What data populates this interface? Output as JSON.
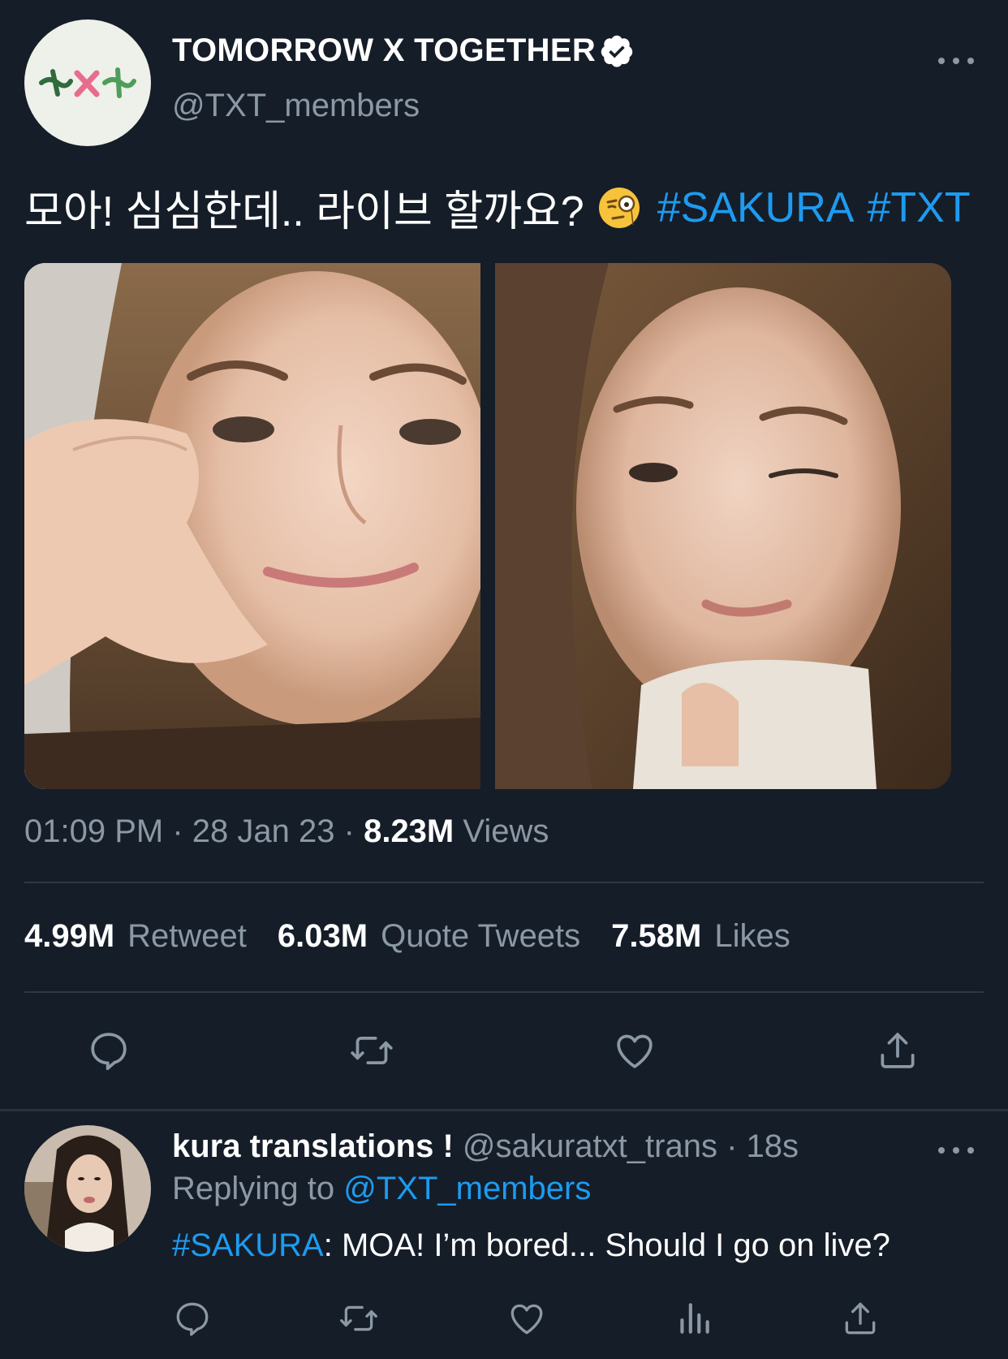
{
  "tweet": {
    "display_name": "TOMORROW X TOGETHER",
    "handle": "@TXT_members",
    "text": "모아! 심심한데.. 라이브 할까요?",
    "hashtags": [
      "#SAKURA",
      "#TXT"
    ],
    "time": "01:09 PM",
    "date": "28 Jan 23",
    "sep": "·",
    "views_count": "8.23M",
    "views_label": "Views",
    "retweet_count": "4.99M",
    "retweet_label": "Retweet",
    "quote_count": "6.03M",
    "quote_label": "Quote Tweets",
    "likes_count": "7.58M",
    "likes_label": "Likes"
  },
  "reply": {
    "display_name": "kura translations !",
    "handle": "@sakuratxt_trans",
    "sep": "·",
    "age": "18s",
    "replying_label": "Replying to",
    "replying_handle": "@TXT_members",
    "hashtag": "#SAKURA",
    "text": ": MOA! I’m bored... Should I go on live?"
  },
  "icons": {
    "main_actions": [
      "reply-icon",
      "retweet-icon",
      "like-icon",
      "share-icon"
    ],
    "reply_actions": [
      "reply-icon",
      "retweet-icon",
      "like-icon",
      "views-icon",
      "share-icon"
    ]
  },
  "colors": {
    "background": "#151d28",
    "accent": "#1d9bf0",
    "muted": "#8b98a5",
    "text": "#ffffff"
  }
}
